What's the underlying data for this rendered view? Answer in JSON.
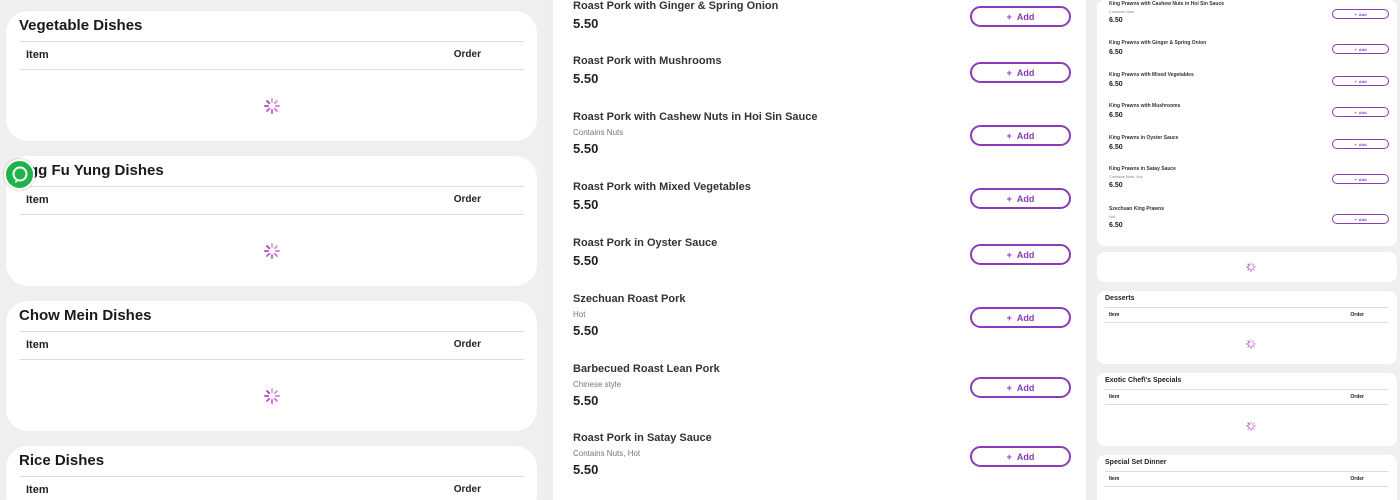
{
  "left_sections": [
    {
      "title": "Vegetable Dishes",
      "col_item": "Item",
      "col_order": "Order"
    },
    {
      "title": "Egg Fu Yung Dishes",
      "col_item": "Item",
      "col_order": "Order"
    },
    {
      "title": "Chow Mein Dishes",
      "col_item": "Item",
      "col_order": "Order"
    },
    {
      "title": "Rice Dishes",
      "col_item": "Item",
      "col_order": "Order"
    }
  ],
  "middle_items": [
    {
      "name": "Roast Pork with Ginger & Spring Onion",
      "note": "",
      "price": "5.50",
      "add": "Add"
    },
    {
      "name": "Roast Pork with Mushrooms",
      "note": "",
      "price": "5.50",
      "add": "Add"
    },
    {
      "name": "Roast Pork with Cashew Nuts in Hoi Sin Sauce",
      "note": "Contains Nuts",
      "price": "5.50",
      "add": "Add"
    },
    {
      "name": "Roast Pork with Mixed Vegetables",
      "note": "",
      "price": "5.50",
      "add": "Add"
    },
    {
      "name": "Roast Pork in Oyster Sauce",
      "note": "",
      "price": "5.50",
      "add": "Add"
    },
    {
      "name": "Szechuan Roast Pork",
      "note": "Hot",
      "price": "5.50",
      "add": "Add"
    },
    {
      "name": "Barbecued Roast Lean Pork",
      "note": "Chinese style",
      "price": "5.50",
      "add": "Add"
    },
    {
      "name": "Roast Pork in Satay Sauce",
      "note": "Contains Nuts, Hot",
      "price": "5.50",
      "add": "Add"
    }
  ],
  "right_items": [
    {
      "name": "King Prawns with Cashew Nuts in Hoi Sin Sauce",
      "note": "Contains Nuts",
      "price": "6.50",
      "add": "Add"
    },
    {
      "name": "King Prawns with Ginger & Spring Onion",
      "note": "",
      "price": "6.50",
      "add": "Add"
    },
    {
      "name": "King Prawns with Mixed Vegetables",
      "note": "",
      "price": "6.50",
      "add": "Add"
    },
    {
      "name": "King Prawns with Mushrooms",
      "note": "",
      "price": "6.50",
      "add": "Add"
    },
    {
      "name": "King Prawns in Oyster Sauce",
      "note": "",
      "price": "6.50",
      "add": "Add"
    },
    {
      "name": "King Prawns in Satay Sauce",
      "note": "Contains Nuts, Hot",
      "price": "6.50",
      "add": "Add"
    },
    {
      "name": "Szechuan King Prawns",
      "note": "Hot",
      "price": "6.50",
      "add": "Add"
    }
  ],
  "right_sections": [
    {
      "title": "Desserts",
      "col_item": "Item",
      "col_order": "Order"
    },
    {
      "title": "Exotic Chef\\'s Specials",
      "col_item": "Item",
      "col_order": "Order"
    },
    {
      "title": "Special Set Dinner",
      "col_item": "Item",
      "col_order": "Order"
    }
  ],
  "currency_glyph": "",
  "icons": {
    "add": "plus-icon",
    "loading": "loading-spinner-icon",
    "chat": "chat-bubble-icon"
  },
  "colors": {
    "accent": "#8c3bb8",
    "spinner": "#b53bc4",
    "chat": "#1fb24a"
  }
}
